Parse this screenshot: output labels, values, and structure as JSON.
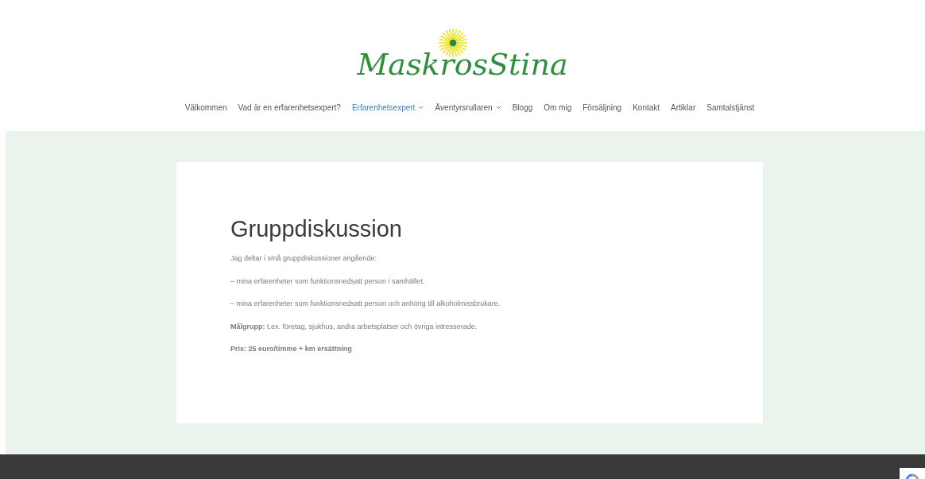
{
  "logo": {
    "text": "MaskrosStina"
  },
  "nav": [
    {
      "label": "Välkommen",
      "selected": false,
      "has_submenu": false
    },
    {
      "label": "Vad är en erfarenhetsexpert?",
      "selected": false,
      "has_submenu": false
    },
    {
      "label": "Erfarenhetsexpert",
      "selected": true,
      "has_submenu": true
    },
    {
      "label": "Äventyrsrullaren",
      "selected": false,
      "has_submenu": true
    },
    {
      "label": "Blogg",
      "selected": false,
      "has_submenu": false
    },
    {
      "label": "Om mig",
      "selected": false,
      "has_submenu": false
    },
    {
      "label": "Försäljning",
      "selected": false,
      "has_submenu": false
    },
    {
      "label": "Kontakt",
      "selected": false,
      "has_submenu": false
    },
    {
      "label": "Artiklar",
      "selected": false,
      "has_submenu": false
    },
    {
      "label": "Samtalstjänst",
      "selected": false,
      "has_submenu": false
    }
  ],
  "article": {
    "title": "Gruppdiskussion",
    "paragraphs": [
      {
        "text": "Jag deltar i små gruppdiskussioner angående:",
        "bold": false
      },
      {
        "text": "–  mina erfarenheter som funktionsnedsatt person i samhället.",
        "bold": false
      },
      {
        "text": "–  mina erfarenheter som funktionsnedsatt person och anhörig till alkoholmissbrukare.",
        "bold": false
      },
      {
        "text": "**Målgrupp:** t.ex. företag, sjukhus, andra arbetsplatser och övriga intresserade.",
        "bold": false
      },
      {
        "text": "Pris: 25 euro/timme + km ersättning",
        "bold": true
      }
    ]
  }
}
